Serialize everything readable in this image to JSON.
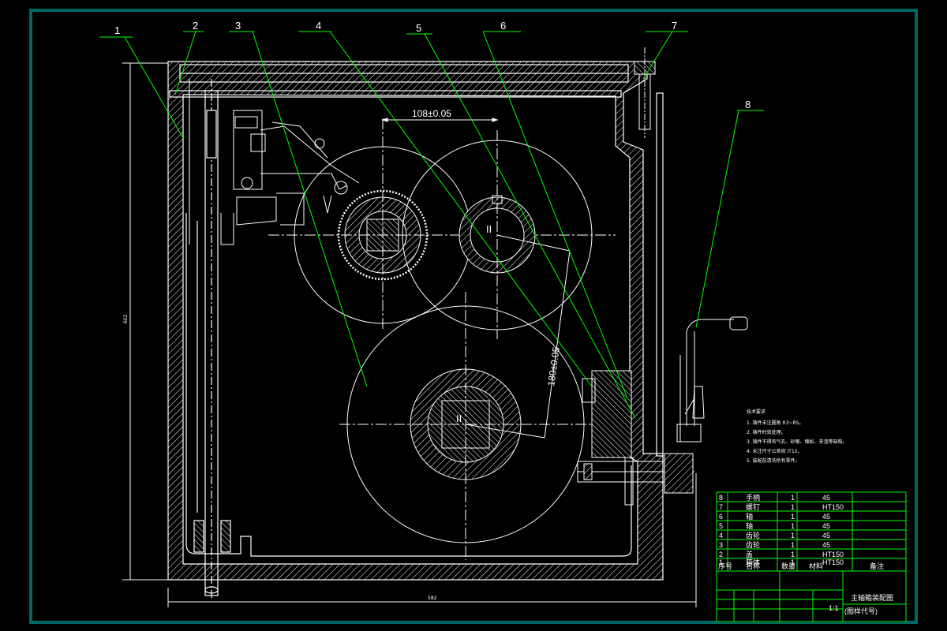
{
  "balloons": [
    "1",
    "2",
    "3",
    "4",
    "5",
    "6",
    "7",
    "8"
  ],
  "dimensions": {
    "center_distance_horizontal": "108±0.05",
    "center_distance_diagonal": "180±0.05",
    "overall_width": "582",
    "overall_height": "602"
  },
  "shaft_marks": [
    "II",
    "II"
  ],
  "tech_notes": {
    "title": "技术要求",
    "lines": [
      "1. 铸件未注圆角 R3~R5。",
      "2. 铸件时效处理。",
      "3. 铸件不得有气孔、砂眼、缩松、夹渣等缺陷。",
      "4. 未注尺寸公差按 IT12。",
      "5. 装配前清洗所有零件。"
    ]
  },
  "parts_list": {
    "rows": [
      {
        "no": "8",
        "name": "手柄",
        "qty": "1",
        "material": "45"
      },
      {
        "no": "7",
        "name": "螺钉",
        "qty": "1",
        "material": "HT150"
      },
      {
        "no": "6",
        "name": "轴",
        "qty": "1",
        "material": "45"
      },
      {
        "no": "5",
        "name": "轴",
        "qty": "1",
        "material": "45"
      },
      {
        "no": "4",
        "name": "齿轮",
        "qty": "1",
        "material": "45"
      },
      {
        "no": "3",
        "name": "齿轮",
        "qty": "1",
        "material": "45"
      },
      {
        "no": "2",
        "name": "盖",
        "qty": "1",
        "material": "HT150"
      },
      {
        "no": "1",
        "name": "箱体",
        "qty": "1",
        "material": "HT150"
      }
    ],
    "header": {
      "no": "序号",
      "name": "名称",
      "qty": "数量",
      "material": "材料",
      "remark": "备注"
    }
  },
  "title_block": {
    "title": "主轴箱装配图",
    "drawing_no": "(图样代号)",
    "scale": "1:1"
  },
  "colors": {
    "background": "#000000",
    "outline": "#ffffff",
    "leader": "#00ff00",
    "frame": "#00cccc"
  }
}
